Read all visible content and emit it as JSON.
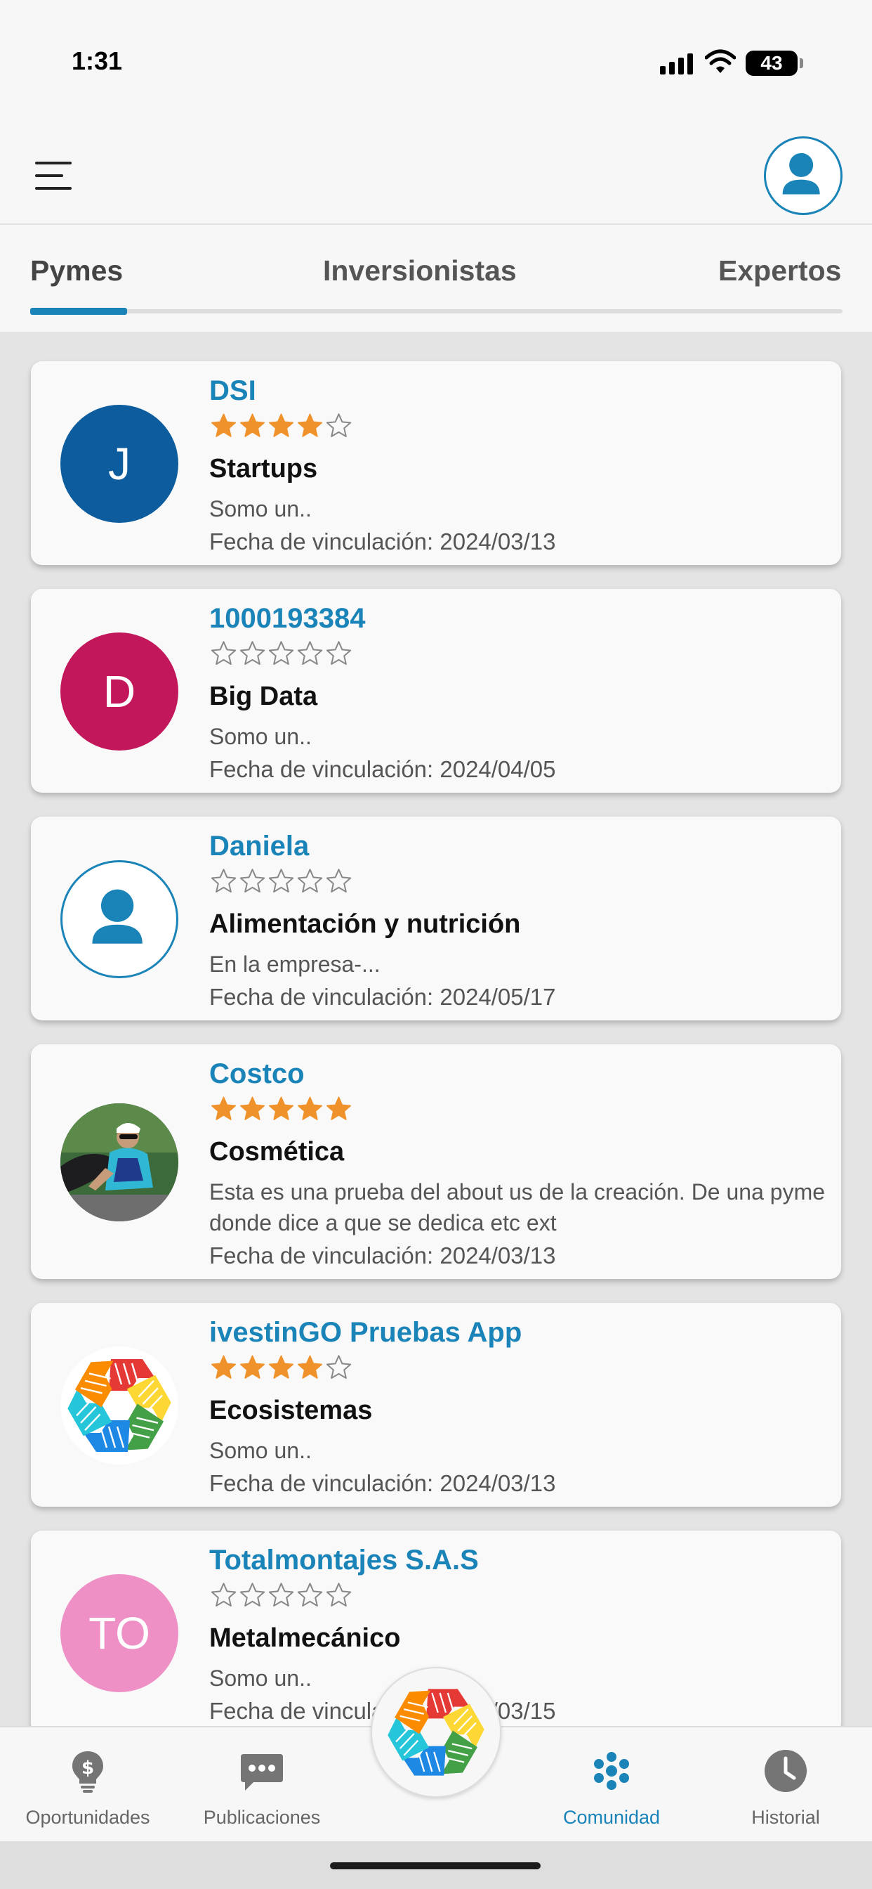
{
  "status_bar": {
    "time": "1:31",
    "battery": "43"
  },
  "header": {
    "menu_icon": "hamburger-icon",
    "profile_icon": "user-icon"
  },
  "tabs": [
    {
      "label": "Pymes",
      "active": true
    },
    {
      "label": "Inversionistas",
      "active": false
    },
    {
      "label": "Expertos",
      "active": false
    }
  ],
  "cards": [
    {
      "name": "DSI",
      "rating": 4,
      "category": "Startups",
      "description": "Somo un..",
      "date": "Fecha de vinculación: 2024/03/13",
      "avatar_type": "initial",
      "avatar_text": "J",
      "avatar_color": "#0d5d9e"
    },
    {
      "name": "1000193384",
      "rating": 0,
      "category": "Big Data",
      "description": "Somo un..",
      "date": "Fecha de vinculación: 2024/04/05",
      "avatar_type": "initial",
      "avatar_text": "D",
      "avatar_color": "#c2185b"
    },
    {
      "name": "Daniela",
      "rating": 0,
      "category": "Alimentación y nutrición",
      "description": "En la empresa-...",
      "date": "Fecha de vinculación: 2024/05/17",
      "avatar_type": "user-icon"
    },
    {
      "name": "Costco",
      "rating": 5,
      "category": "Cosmética",
      "description": "Esta es una prueba del about us de la creación. De una pyme donde dice a que se dedica etc ext",
      "date": "Fecha de vinculación: 2024/03/13",
      "avatar_type": "photo-cyclist"
    },
    {
      "name": "ivestinGO Pruebas App",
      "rating": 4,
      "category": "Ecosistemas",
      "description": "Somo un..",
      "date": "Fecha de vinculación: 2024/03/13",
      "avatar_type": "logo-hands"
    },
    {
      "name": "Totalmontajes S.A.S",
      "rating": 0,
      "category": "Metalmecánico",
      "description": "Somo un..",
      "date": "Fecha de vinculación: 2024/03/15",
      "avatar_type": "initial",
      "avatar_text": "TO",
      "avatar_color": "#ee8fc6"
    }
  ],
  "bottom_nav": [
    {
      "label": "Oportunidades",
      "icon": "lightbulb-dollar-icon",
      "active": false
    },
    {
      "label": "Publicaciones",
      "icon": "chat-bubble-icon",
      "active": false
    },
    {
      "label": "Comunidad",
      "icon": "community-icon",
      "active": true
    },
    {
      "label": "Historial",
      "icon": "clock-icon",
      "active": false
    }
  ],
  "center_button_icon": "investingo-logo-icon",
  "colors": {
    "accent": "#1a84b8",
    "star": "#f0922b"
  }
}
